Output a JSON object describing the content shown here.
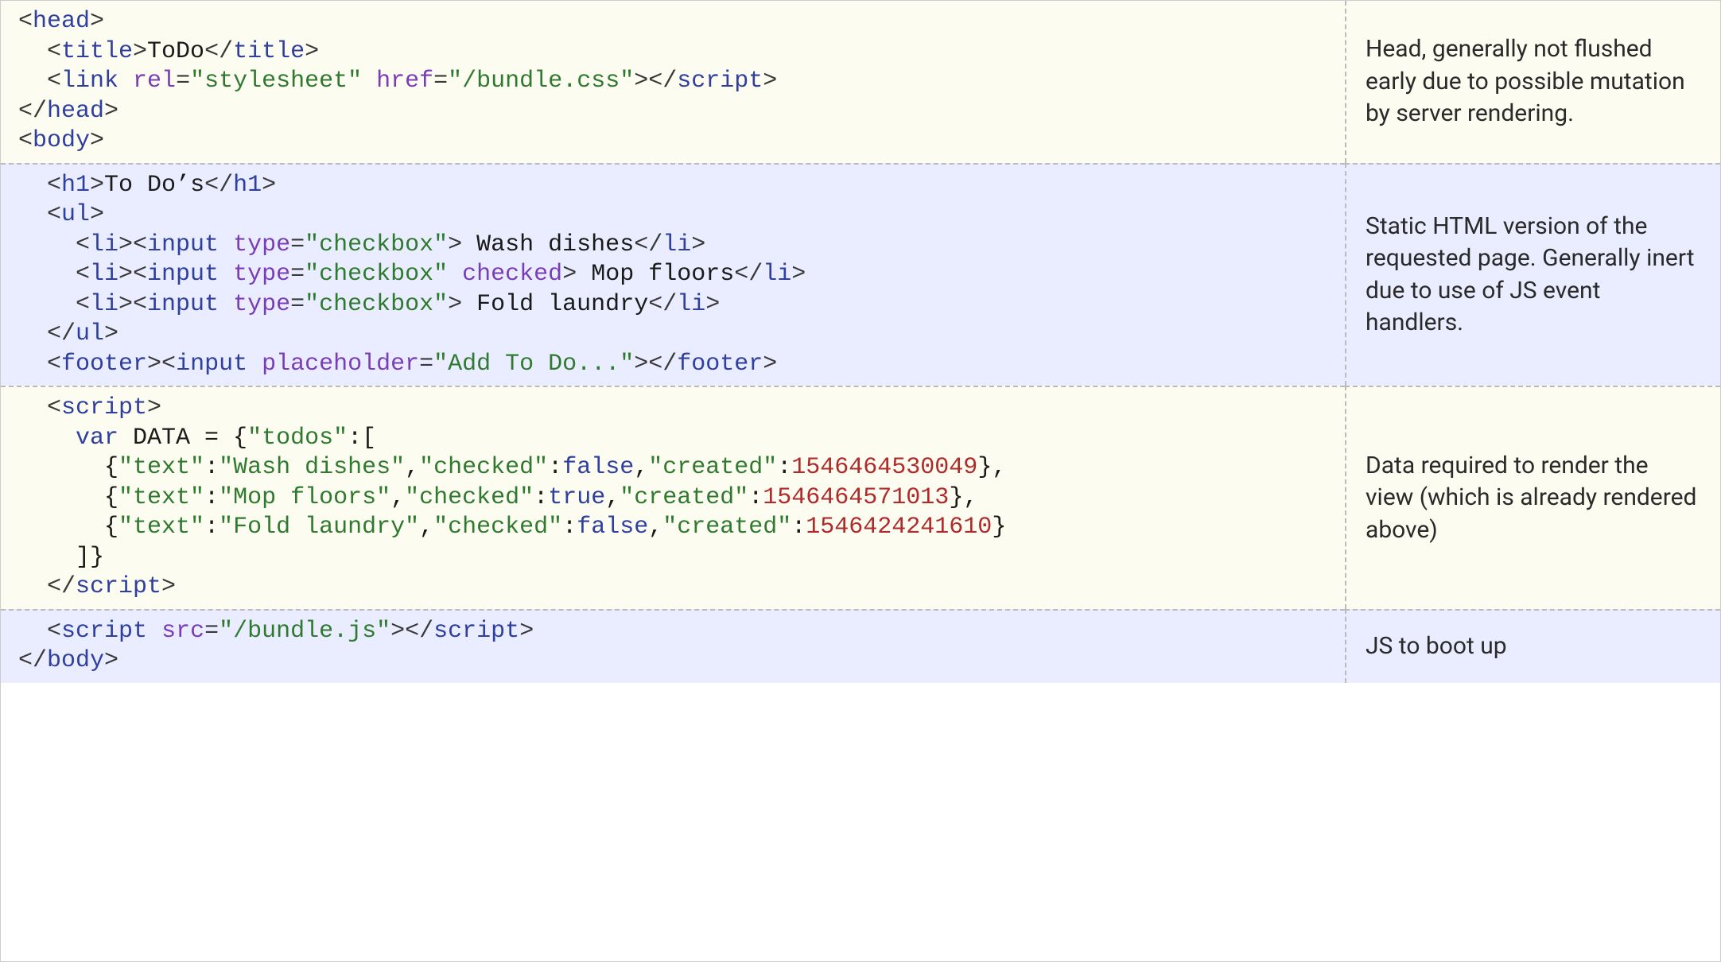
{
  "rows": [
    {
      "bg": "cream",
      "desc": "Head, generally not flushed early due to possible mutation by server rendering.",
      "lines": [
        [
          {
            "c": "p",
            "t": "<"
          },
          {
            "c": "t",
            "t": "head"
          },
          {
            "c": "p",
            "t": ">"
          }
        ],
        [
          {
            "c": "p",
            "t": "  <"
          },
          {
            "c": "t",
            "t": "title"
          },
          {
            "c": "p",
            "t": ">"
          },
          {
            "c": "id",
            "t": "ToDo"
          },
          {
            "c": "p",
            "t": "</"
          },
          {
            "c": "t",
            "t": "title"
          },
          {
            "c": "p",
            "t": ">"
          }
        ],
        [
          {
            "c": "p",
            "t": "  <"
          },
          {
            "c": "t",
            "t": "link"
          },
          {
            "c": "id",
            "t": " "
          },
          {
            "c": "a",
            "t": "rel"
          },
          {
            "c": "p",
            "t": "="
          },
          {
            "c": "s",
            "t": "\"stylesheet\""
          },
          {
            "c": "id",
            "t": " "
          },
          {
            "c": "a",
            "t": "href"
          },
          {
            "c": "p",
            "t": "="
          },
          {
            "c": "s",
            "t": "\"/bundle.css\""
          },
          {
            "c": "p",
            "t": "></"
          },
          {
            "c": "t",
            "t": "script"
          },
          {
            "c": "p",
            "t": ">"
          }
        ],
        [
          {
            "c": "p",
            "t": "</"
          },
          {
            "c": "t",
            "t": "head"
          },
          {
            "c": "p",
            "t": ">"
          }
        ],
        [
          {
            "c": "p",
            "t": "<"
          },
          {
            "c": "t",
            "t": "body"
          },
          {
            "c": "p",
            "t": ">"
          }
        ]
      ]
    },
    {
      "bg": "blue",
      "desc": "Static HTML version of the requested page. Generally inert due to use of JS event handlers.",
      "lines": [
        [
          {
            "c": "p",
            "t": "  <"
          },
          {
            "c": "t",
            "t": "h1"
          },
          {
            "c": "p",
            "t": ">"
          },
          {
            "c": "id",
            "t": "To Do’s"
          },
          {
            "c": "p",
            "t": "</"
          },
          {
            "c": "t",
            "t": "h1"
          },
          {
            "c": "p",
            "t": ">"
          }
        ],
        [
          {
            "c": "p",
            "t": "  <"
          },
          {
            "c": "t",
            "t": "ul"
          },
          {
            "c": "p",
            "t": ">"
          }
        ],
        [
          {
            "c": "p",
            "t": "    <"
          },
          {
            "c": "t",
            "t": "li"
          },
          {
            "c": "p",
            "t": "><"
          },
          {
            "c": "t",
            "t": "input"
          },
          {
            "c": "id",
            "t": " "
          },
          {
            "c": "a",
            "t": "type"
          },
          {
            "c": "p",
            "t": "="
          },
          {
            "c": "s",
            "t": "\"checkbox\""
          },
          {
            "c": "p",
            "t": ">"
          },
          {
            "c": "id",
            "t": " Wash dishes"
          },
          {
            "c": "p",
            "t": "</"
          },
          {
            "c": "t",
            "t": "li"
          },
          {
            "c": "p",
            "t": ">"
          }
        ],
        [
          {
            "c": "p",
            "t": "    <"
          },
          {
            "c": "t",
            "t": "li"
          },
          {
            "c": "p",
            "t": "><"
          },
          {
            "c": "t",
            "t": "input"
          },
          {
            "c": "id",
            "t": " "
          },
          {
            "c": "a",
            "t": "type"
          },
          {
            "c": "p",
            "t": "="
          },
          {
            "c": "s",
            "t": "\"checkbox\""
          },
          {
            "c": "id",
            "t": " "
          },
          {
            "c": "a",
            "t": "checked"
          },
          {
            "c": "p",
            "t": ">"
          },
          {
            "c": "id",
            "t": " Mop floors"
          },
          {
            "c": "p",
            "t": "</"
          },
          {
            "c": "t",
            "t": "li"
          },
          {
            "c": "p",
            "t": ">"
          }
        ],
        [
          {
            "c": "p",
            "t": "    <"
          },
          {
            "c": "t",
            "t": "li"
          },
          {
            "c": "p",
            "t": "><"
          },
          {
            "c": "t",
            "t": "input"
          },
          {
            "c": "id",
            "t": " "
          },
          {
            "c": "a",
            "t": "type"
          },
          {
            "c": "p",
            "t": "="
          },
          {
            "c": "s",
            "t": "\"checkbox\""
          },
          {
            "c": "p",
            "t": ">"
          },
          {
            "c": "id",
            "t": " Fold laundry"
          },
          {
            "c": "p",
            "t": "</"
          },
          {
            "c": "t",
            "t": "li"
          },
          {
            "c": "p",
            "t": ">"
          }
        ],
        [
          {
            "c": "p",
            "t": "  </"
          },
          {
            "c": "t",
            "t": "ul"
          },
          {
            "c": "p",
            "t": ">"
          }
        ],
        [
          {
            "c": "p",
            "t": "  <"
          },
          {
            "c": "t",
            "t": "footer"
          },
          {
            "c": "p",
            "t": "><"
          },
          {
            "c": "t",
            "t": "input"
          },
          {
            "c": "id",
            "t": " "
          },
          {
            "c": "a",
            "t": "placeholder"
          },
          {
            "c": "p",
            "t": "="
          },
          {
            "c": "s",
            "t": "\"Add To Do...\""
          },
          {
            "c": "p",
            "t": "></"
          },
          {
            "c": "t",
            "t": "footer"
          },
          {
            "c": "p",
            "t": ">"
          }
        ]
      ]
    },
    {
      "bg": "cream",
      "desc": "Data required to render the view (which is already rendered above)",
      "lines": [
        [
          {
            "c": "p",
            "t": "  <"
          },
          {
            "c": "t",
            "t": "script"
          },
          {
            "c": "p",
            "t": ">"
          }
        ],
        [
          {
            "c": "id",
            "t": "    "
          },
          {
            "c": "k",
            "t": "var"
          },
          {
            "c": "id",
            "t": " DATA = {"
          },
          {
            "c": "s",
            "t": "\"todos\""
          },
          {
            "c": "id",
            "t": ":["
          }
        ],
        [
          {
            "c": "id",
            "t": "      {"
          },
          {
            "c": "s",
            "t": "\"text\""
          },
          {
            "c": "id",
            "t": ":"
          },
          {
            "c": "s",
            "t": "\"Wash dishes\""
          },
          {
            "c": "id",
            "t": ","
          },
          {
            "c": "s",
            "t": "\"checked\""
          },
          {
            "c": "id",
            "t": ":"
          },
          {
            "c": "b",
            "t": "false"
          },
          {
            "c": "id",
            "t": ","
          },
          {
            "c": "s",
            "t": "\"created\""
          },
          {
            "c": "id",
            "t": ":"
          },
          {
            "c": "n",
            "t": "1546464530049"
          },
          {
            "c": "id",
            "t": "},"
          }
        ],
        [
          {
            "c": "id",
            "t": "      {"
          },
          {
            "c": "s",
            "t": "\"text\""
          },
          {
            "c": "id",
            "t": ":"
          },
          {
            "c": "s",
            "t": "\"Mop floors\""
          },
          {
            "c": "id",
            "t": ","
          },
          {
            "c": "s",
            "t": "\"checked\""
          },
          {
            "c": "id",
            "t": ":"
          },
          {
            "c": "b",
            "t": "true"
          },
          {
            "c": "id",
            "t": ","
          },
          {
            "c": "s",
            "t": "\"created\""
          },
          {
            "c": "id",
            "t": ":"
          },
          {
            "c": "n",
            "t": "1546464571013"
          },
          {
            "c": "id",
            "t": "},"
          }
        ],
        [
          {
            "c": "id",
            "t": "      {"
          },
          {
            "c": "s",
            "t": "\"text\""
          },
          {
            "c": "id",
            "t": ":"
          },
          {
            "c": "s",
            "t": "\"Fold laundry\""
          },
          {
            "c": "id",
            "t": ","
          },
          {
            "c": "s",
            "t": "\"checked\""
          },
          {
            "c": "id",
            "t": ":"
          },
          {
            "c": "b",
            "t": "false"
          },
          {
            "c": "id",
            "t": ","
          },
          {
            "c": "s",
            "t": "\"created\""
          },
          {
            "c": "id",
            "t": ":"
          },
          {
            "c": "n",
            "t": "1546424241610"
          },
          {
            "c": "id",
            "t": "}"
          }
        ],
        [
          {
            "c": "id",
            "t": "    ]}"
          }
        ],
        [
          {
            "c": "p",
            "t": "  </"
          },
          {
            "c": "t",
            "t": "script"
          },
          {
            "c": "p",
            "t": ">"
          }
        ]
      ]
    },
    {
      "bg": "blue",
      "desc": "JS to boot up",
      "lines": [
        [
          {
            "c": "p",
            "t": "  <"
          },
          {
            "c": "t",
            "t": "script"
          },
          {
            "c": "id",
            "t": " "
          },
          {
            "c": "a",
            "t": "src"
          },
          {
            "c": "p",
            "t": "="
          },
          {
            "c": "s",
            "t": "\"/bundle.js\""
          },
          {
            "c": "p",
            "t": "></"
          },
          {
            "c": "t",
            "t": "script"
          },
          {
            "c": "p",
            "t": ">"
          }
        ],
        [
          {
            "c": "p",
            "t": "</"
          },
          {
            "c": "t",
            "t": "body"
          },
          {
            "c": "p",
            "t": ">"
          }
        ]
      ]
    }
  ]
}
